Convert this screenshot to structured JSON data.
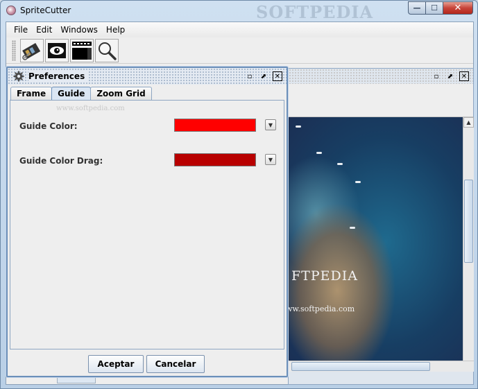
{
  "window": {
    "title": "SpriteCutter",
    "watermark": "SOFTPEDIA",
    "controls": {
      "minimize": "—",
      "maximize": "☐",
      "close": "✕"
    }
  },
  "menubar": {
    "items": [
      {
        "label": "File"
      },
      {
        "label": "Edit"
      },
      {
        "label": "Windows"
      },
      {
        "label": "Help"
      }
    ]
  },
  "toolbar": {
    "buttons": [
      {
        "icon": "film-cut-icon"
      },
      {
        "icon": "eye-preview-icon"
      },
      {
        "icon": "sprite-sheet-icon"
      },
      {
        "icon": "magnifier-icon"
      }
    ]
  },
  "image_frame": {
    "brand_text": "FTPEDIA",
    "url_text": "ww.softpedia.com",
    "controls": {
      "minimize": "▫",
      "maximize": "⬈",
      "close": "✕"
    }
  },
  "preferences": {
    "title": "Preferences",
    "controls": {
      "minimize": "▫",
      "maximize": "⬈",
      "close": "✕"
    },
    "tabs": [
      {
        "label": "Frame",
        "active": false
      },
      {
        "label": "Guide",
        "active": true
      },
      {
        "label": "Zoom Grid",
        "active": false
      }
    ],
    "panel_watermark": "www.softpedia.com",
    "fields": [
      {
        "label": "Guide Color:",
        "color": "#ff0000"
      },
      {
        "label": "Guide Color Drag:",
        "color": "#b80000"
      }
    ],
    "accept_label": "Aceptar",
    "cancel_label": "Cancelar"
  },
  "colors": {
    "accent": "#6b8fb9",
    "guide_color": "#ff0000",
    "guide_color_drag": "#b80000"
  }
}
